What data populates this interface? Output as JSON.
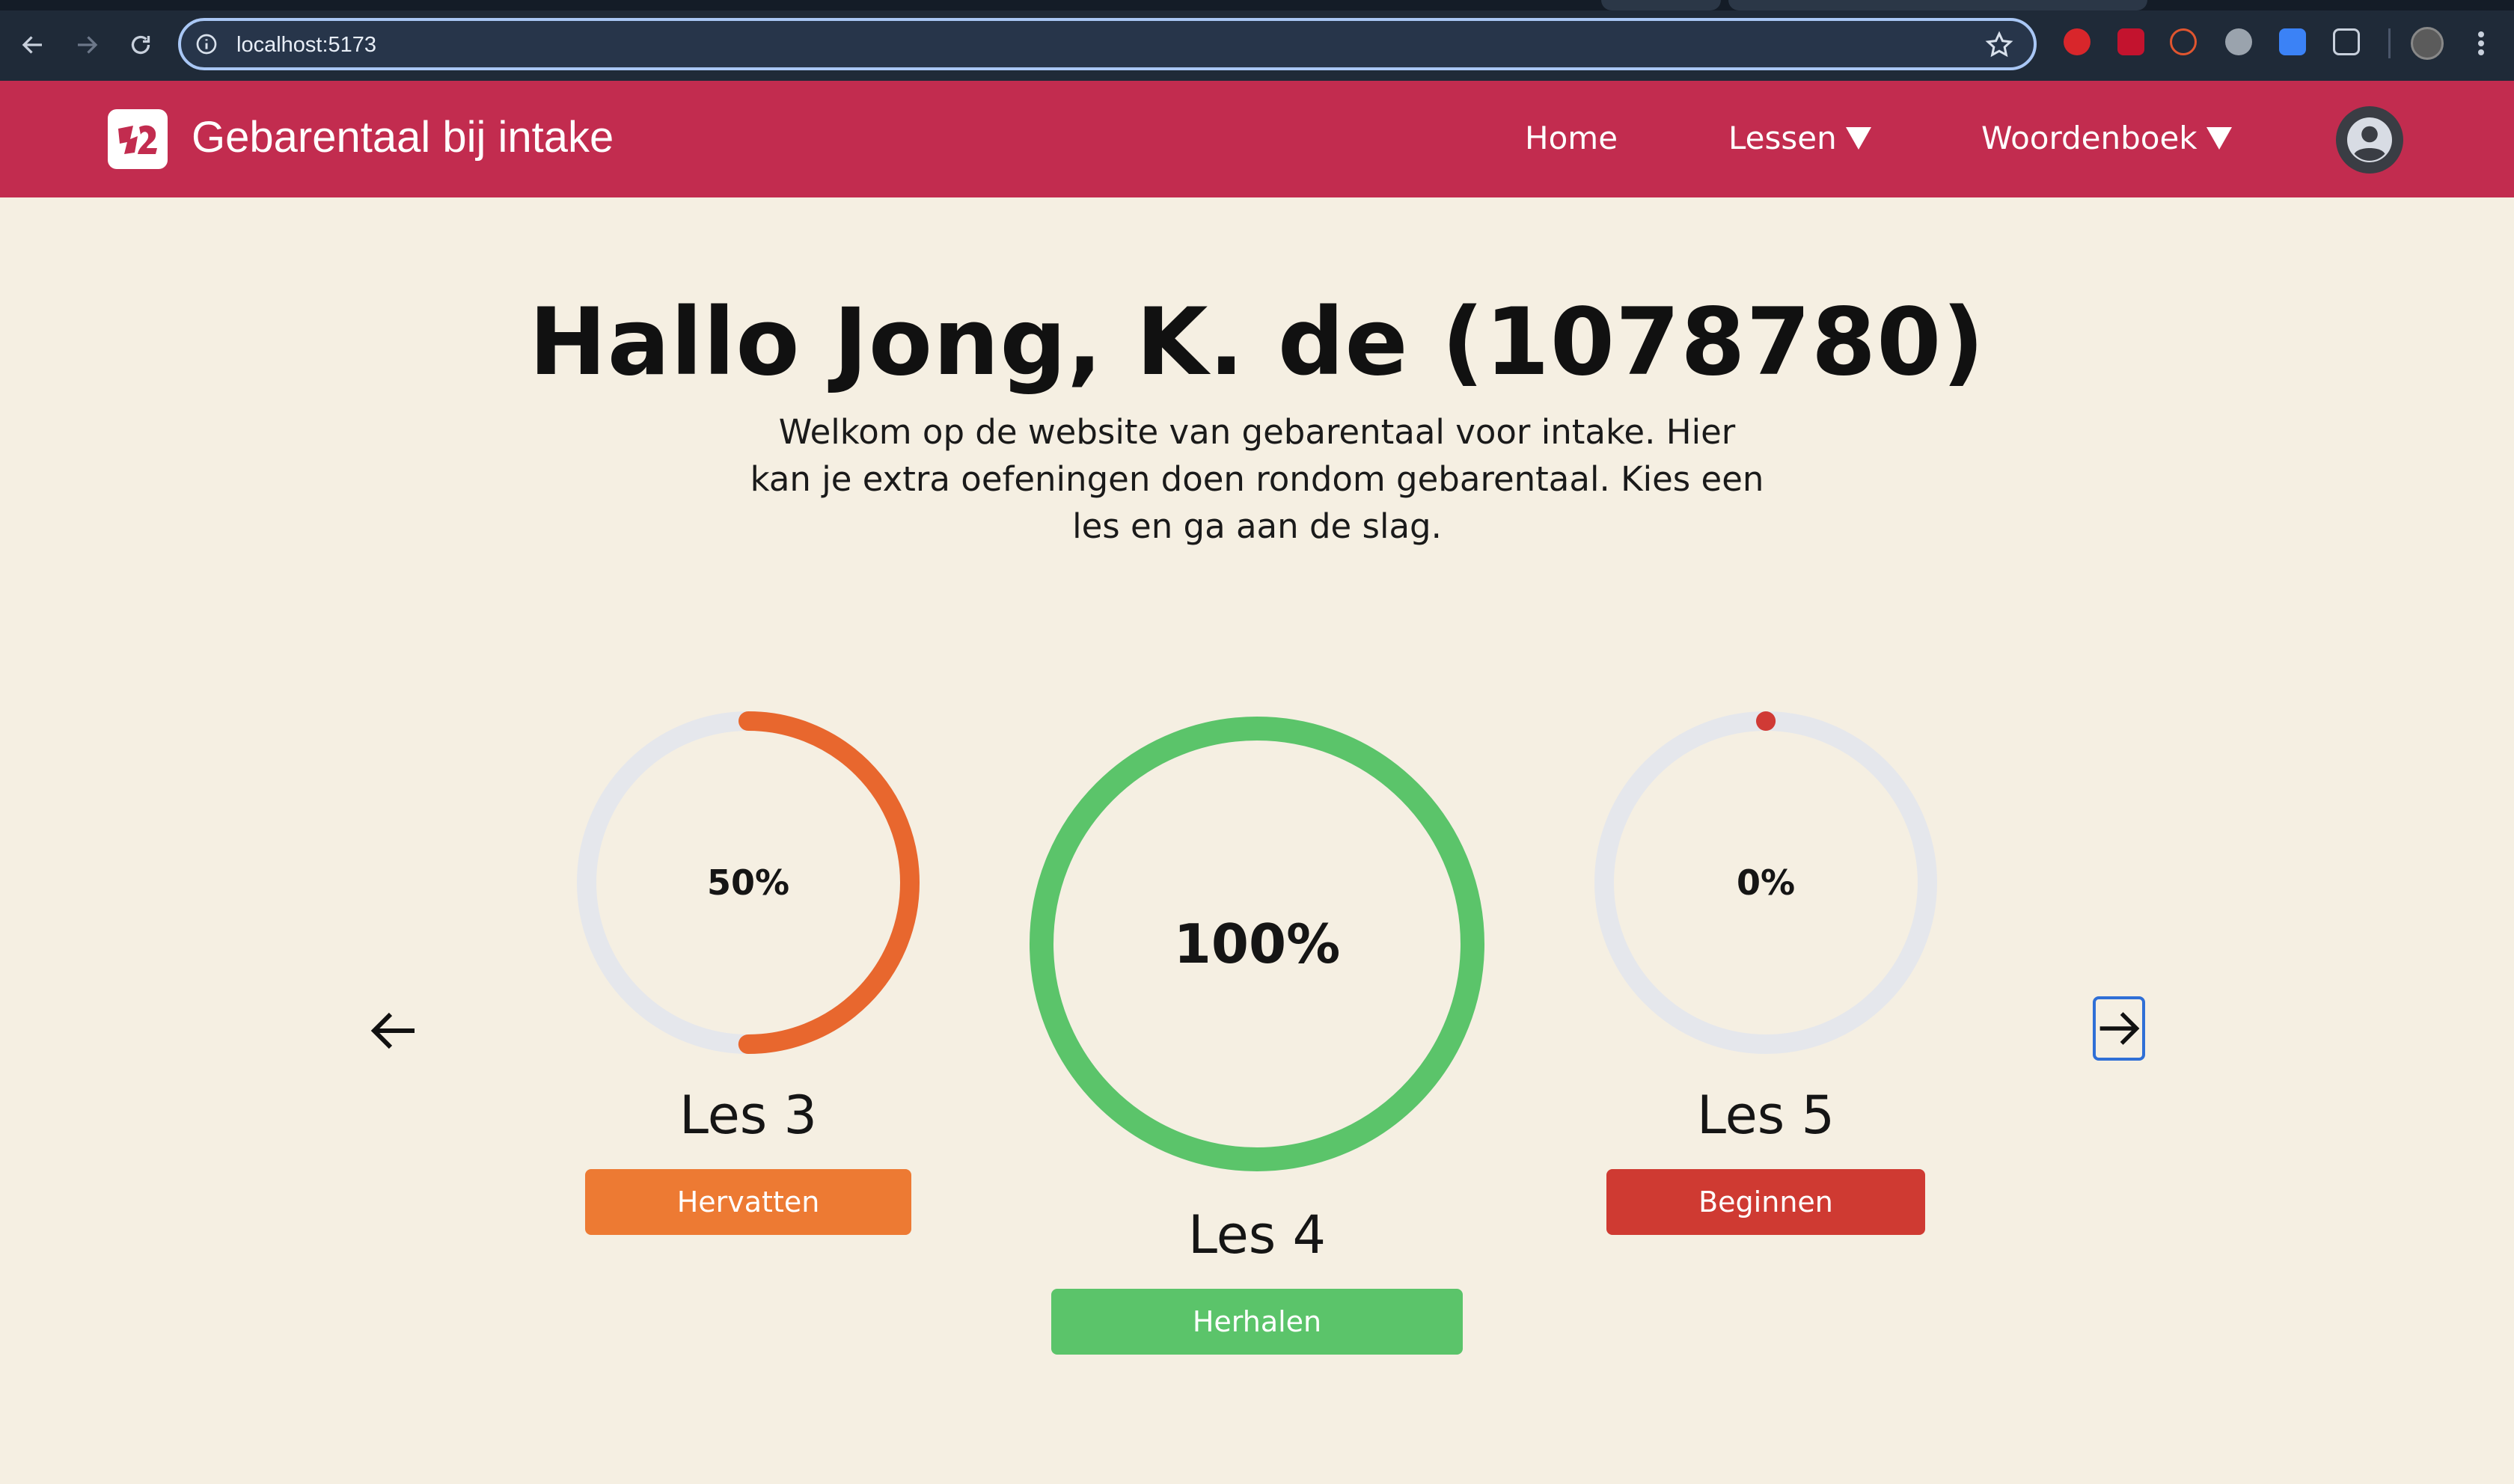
{
  "browser": {
    "url": "localhost:5173",
    "accent": "#a9c7f5"
  },
  "header": {
    "brand": "Gebarentaal bij intake",
    "nav": {
      "home": "Home",
      "lessen": "Lessen",
      "woordenboek": "Woordenboek"
    },
    "color": "#c22c4f"
  },
  "main": {
    "title": "Hallo Jong, K. de (1078780)",
    "intro": "Welkom op de website van gebarentaal voor intake. Hier kan je extra oefeningen doen rondom gebarentaal. Kies een les en ga aan de slag."
  },
  "lessons": [
    {
      "label": "Les 3",
      "progress_text": "50%",
      "progress": 0.5,
      "button": "Hervatten",
      "color": "#e8672e",
      "button_color": "#ed7a33"
    },
    {
      "label": "Les 4",
      "progress_text": "100%",
      "progress": 1.0,
      "button": "Herhalen",
      "color": "#5bc46a",
      "button_color": "#5bc46a"
    },
    {
      "label": "Les 5",
      "progress_text": "0%",
      "progress": 0.0,
      "button": "Beginnen",
      "color": "#d03a35",
      "button_color": "#cf3a32"
    }
  ],
  "colors": {
    "background": "#f5efe2",
    "track": "#e5e7ec"
  },
  "icons": [
    "back-icon",
    "forward-icon",
    "reload-icon",
    "info-icon",
    "star-icon",
    "arrow-left-icon",
    "arrow-right-icon",
    "user-icon"
  ]
}
